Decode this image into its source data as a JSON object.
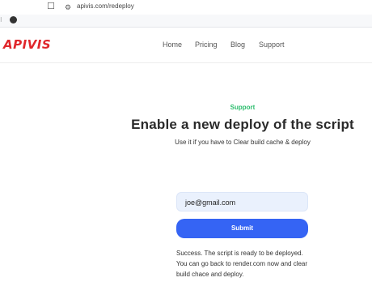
{
  "browser": {
    "url": "apivis.com/redeploy"
  },
  "header": {
    "logo": "APIVIS",
    "nav": [
      "Home",
      "Pricing",
      "Blog",
      "Support"
    ]
  },
  "main": {
    "eyebrow": "Support",
    "title": "Enable a new deploy of the script",
    "subtitle": "Use it if you have to Clear build cache & deploy",
    "email_value": "joe@gmail.com",
    "submit_label": "Submit",
    "success_text": "Success. The script is ready to be deployed. You can go back to render.com now and clear build chace and deploy."
  },
  "colors": {
    "brand": "#e0262b",
    "accent_green": "#2dbd6e",
    "button_blue": "#3564f4",
    "input_bg": "#eaf1fd"
  }
}
